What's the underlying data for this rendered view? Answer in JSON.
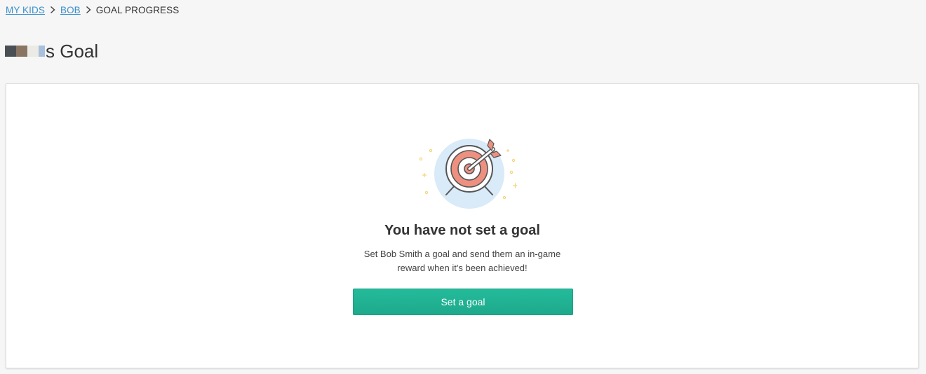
{
  "breadcrumb": {
    "items": [
      {
        "label": "MY KIDS",
        "link": true
      },
      {
        "label": "BOB",
        "link": true
      },
      {
        "label": "GOAL PROGRESS",
        "link": false
      }
    ],
    "separator_icon": "chevron-right-icon"
  },
  "header": {
    "title_suffix": "s Goal",
    "redacted_name_colors": [
      "#4a4f55",
      "#8a7565",
      "#eceae4",
      "#a8c0dc"
    ]
  },
  "empty_state": {
    "icon": "target-with-arrow-icon",
    "heading": "You have not set a goal",
    "description_line1": "Set Bob Smith a goal and send them an in-game",
    "description_line2": "reward when it's been achieved!",
    "button_label": "Set a goal"
  },
  "colors": {
    "background": "#f6f6f6",
    "link": "#3a8fcd",
    "button": "#20b191",
    "target_circle_bg": "#d9eaf8",
    "target_red": "#ee9080",
    "sparkle": "#f3d57a"
  }
}
